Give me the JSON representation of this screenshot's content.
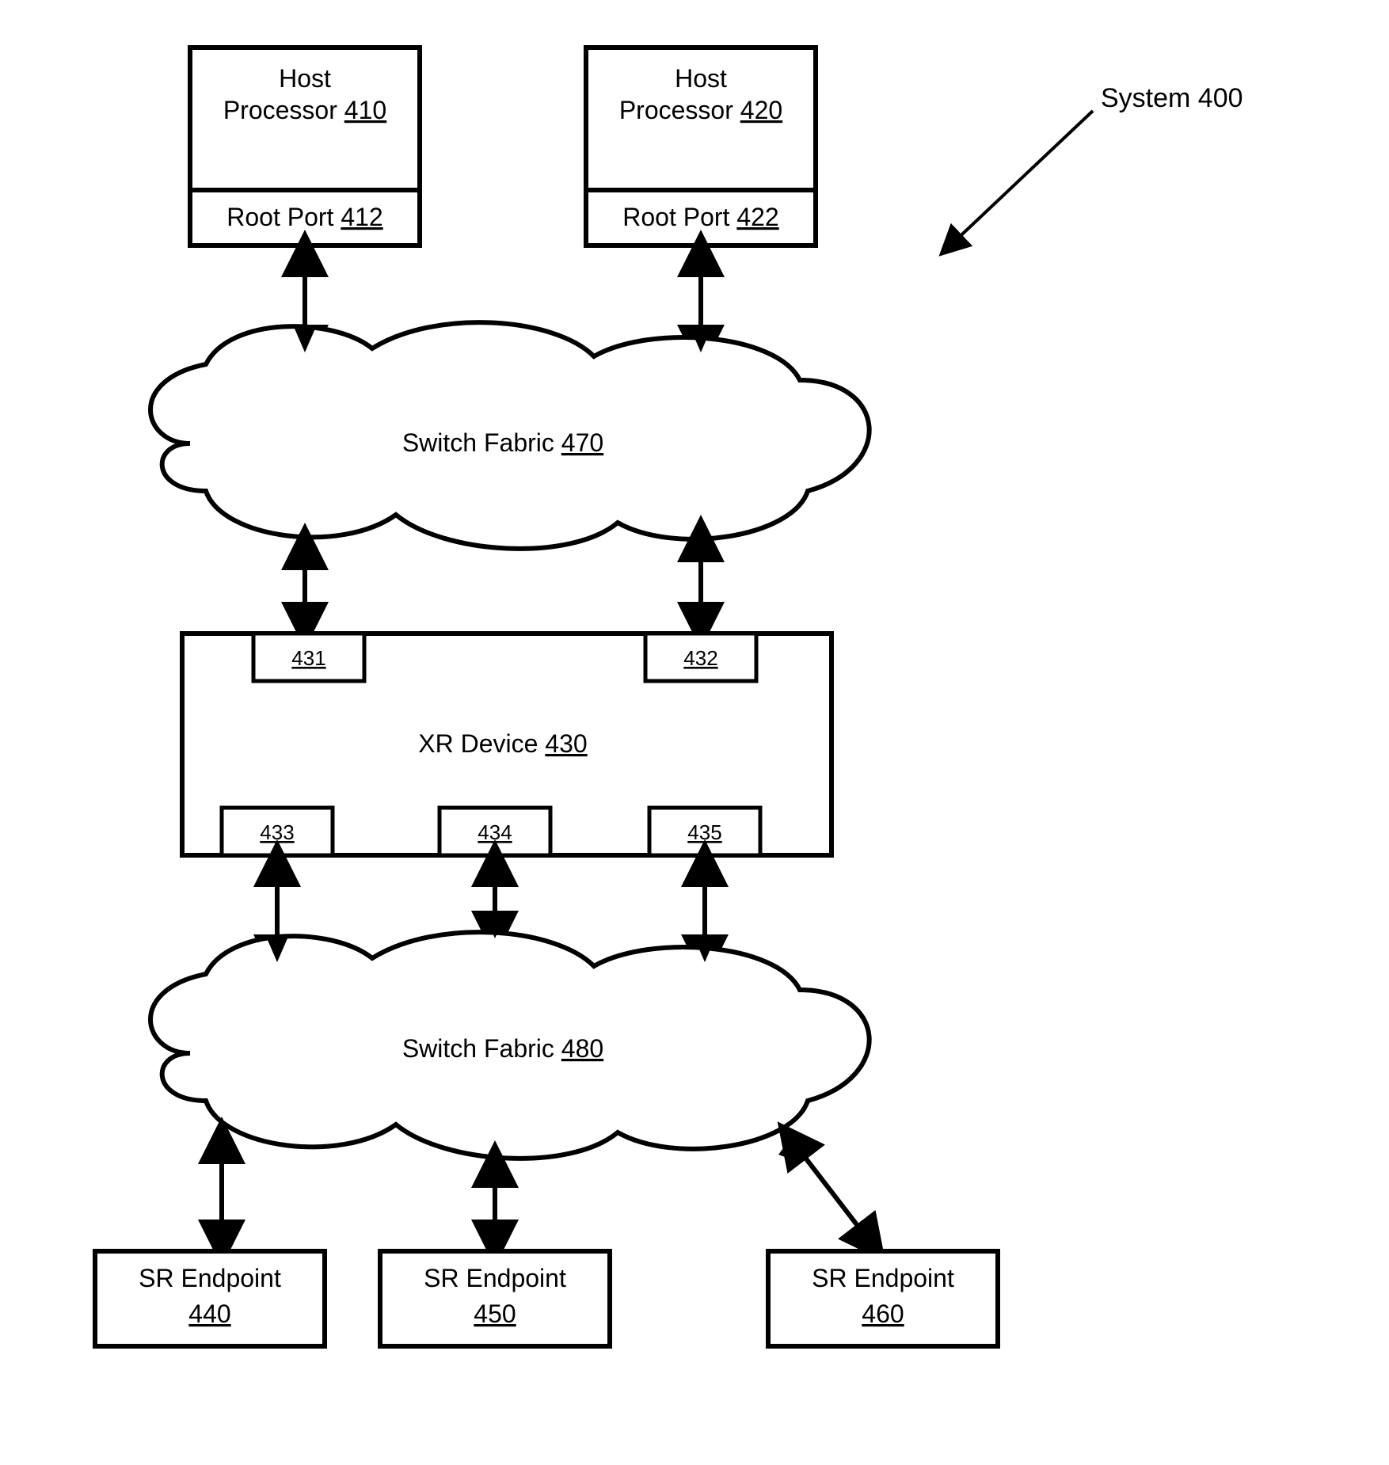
{
  "system_label": "System 400",
  "host1": {
    "title": "Host",
    "subtitle": "Processor",
    "ref": "410",
    "port_label": "Root Port",
    "port_ref": "412"
  },
  "host2": {
    "title": "Host",
    "subtitle": "Processor",
    "ref": "420",
    "port_label": "Root Port",
    "port_ref": "422"
  },
  "fabric1": {
    "label": "Switch Fabric",
    "ref": "470"
  },
  "xr": {
    "label": "XR Device",
    "ref": "430",
    "ports": {
      "p1": "431",
      "p2": "432",
      "p3": "433",
      "p4": "434",
      "p5": "435"
    }
  },
  "fabric2": {
    "label": "Switch Fabric",
    "ref": "480"
  },
  "ep1": {
    "title": "SR  Endpoint",
    "ref": "440"
  },
  "ep2": {
    "title": "SR  Endpoint",
    "ref": "450"
  },
  "ep3": {
    "title": "SR  Endpoint",
    "ref": "460"
  }
}
